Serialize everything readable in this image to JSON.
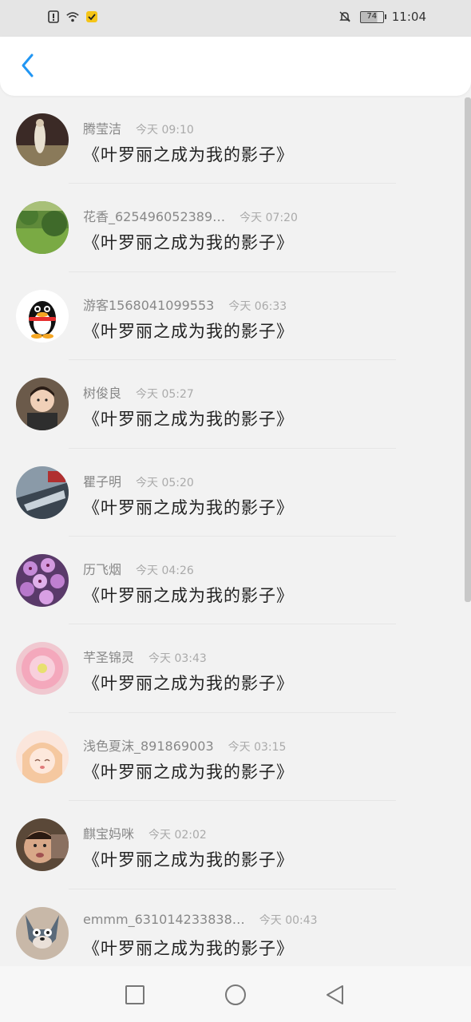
{
  "status_bar": {
    "battery": "74",
    "time": "11:04",
    "icons": [
      "alert-icon",
      "wifi-icon",
      "notification-badge-icon",
      "mute-icon",
      "battery-icon"
    ]
  },
  "header": {
    "back_icon": "chevron-left-icon",
    "accent": "#2196f3"
  },
  "items": [
    {
      "name": "腾莹洁",
      "time": "今天 09:10",
      "text": "《叶罗丽之成为我的影子》"
    },
    {
      "name": "花香_625496052389…",
      "time": "今天 07:20",
      "text": "《叶罗丽之成为我的影子》"
    },
    {
      "name": "游客1568041099553",
      "time": "今天 06:33",
      "text": "《叶罗丽之成为我的影子》"
    },
    {
      "name": "树俊良",
      "time": "今天 05:27",
      "text": "《叶罗丽之成为我的影子》"
    },
    {
      "name": "瞿子明",
      "time": "今天 05:20",
      "text": "《叶罗丽之成为我的影子》"
    },
    {
      "name": "历飞烟",
      "time": "今天 04:26",
      "text": "《叶罗丽之成为我的影子》"
    },
    {
      "name": "芊圣锦灵",
      "time": "今天 03:43",
      "text": "《叶罗丽之成为我的影子》"
    },
    {
      "name": "浅色夏沫_891869003",
      "time": "今天 03:15",
      "text": "《叶罗丽之成为我的影子》"
    },
    {
      "name": "麒宝妈咪",
      "time": "今天 02:02",
      "text": "《叶罗丽之成为我的影子》"
    },
    {
      "name": "emmm_631014233838…",
      "time": "今天 00:43",
      "text": "《叶罗丽之成为我的影子》"
    }
  ],
  "nav": {
    "icons": [
      "recent-apps-icon",
      "home-icon",
      "back-icon"
    ]
  }
}
